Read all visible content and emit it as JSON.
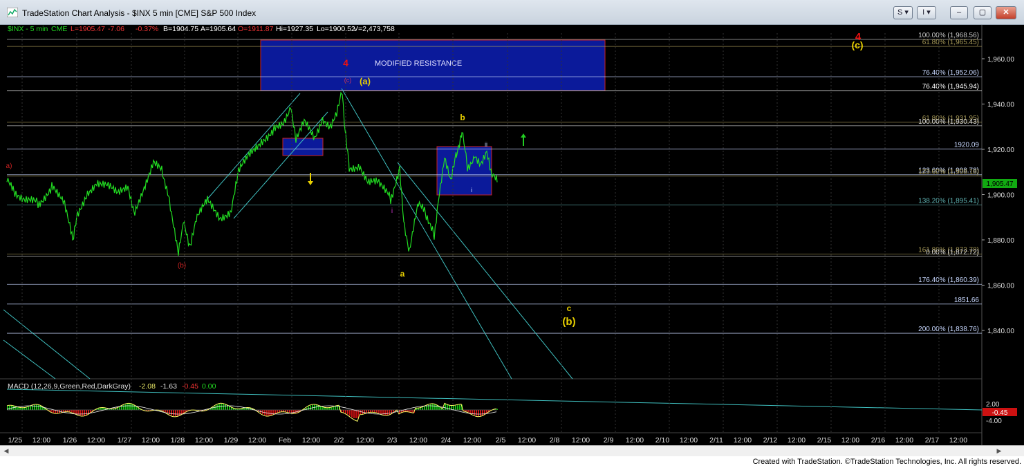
{
  "window": {
    "title": "TradeStation Chart Analysis - $INX 5 min [CME] S&P 500 Index",
    "buttons": [
      "S",
      "I"
    ]
  },
  "header": {
    "symbol": "$INX - 5 min",
    "exchange": "CME",
    "last": "L=1905.47",
    "change": "-7.06",
    "change_pct": "-0.37%",
    "bid": "B=1904.75",
    "ask": "A=1905.64",
    "open": "O=1911.87",
    "high": "Hi=1927.35",
    "low": "Lo=1900.52",
    "volume": "V=2,473,758"
  },
  "price_axis": {
    "ticks": [
      "1,960.00",
      "1,940.00",
      "1,920.00",
      "1,900.00",
      "1,880.00",
      "1,860.00",
      "1,840.00"
    ],
    "last_price": "1,905.47"
  },
  "level_labels": [
    {
      "text": "100.00% (1,968.56)",
      "price": 1968.56,
      "color": "#cccccc"
    },
    {
      "text": "61.80% (1,965.45)",
      "price": 1965.45,
      "color": "#a89a58"
    },
    {
      "text": "76.40% (1,952.06)",
      "price": 1952.06,
      "color": "#c8d8ff"
    },
    {
      "text": "76.40% (1,945.94)",
      "price": 1945.94,
      "color": "#ffffff"
    },
    {
      "text": "61.80% (1,931.95)",
      "price": 1931.95,
      "color": "#a89a58"
    },
    {
      "text": "100.00% (1,930.43)",
      "price": 1930.43,
      "color": "#d8d8d8"
    },
    {
      "text": "1920.09",
      "price": 1920.09,
      "color": "#c8d8ff"
    },
    {
      "text": "123.60% (1,908.78)",
      "price": 1908.78,
      "color": "#c8d8ff"
    },
    {
      "text": "123.60% (1,908.18)",
      "price": 1908.18,
      "color": "#a89a58"
    },
    {
      "text": "138.20% (1,895.41)",
      "price": 1895.41,
      "color": "#5fb3b3"
    },
    {
      "text": "161.80% (1,873.78)",
      "price": 1873.78,
      "color": "#a89a58"
    },
    {
      "text": "0.00% (1,872.72)",
      "price": 1872.72,
      "color": "#d8d8d8"
    },
    {
      "text": "176.40% (1,860.39)",
      "price": 1860.39,
      "color": "#c8d8ff"
    },
    {
      "text": "1851.66",
      "price": 1851.66,
      "color": "#c8d8ff"
    },
    {
      "text": "200.00% (1,838.76)",
      "price": 1838.76,
      "color": "#c8d8ff"
    }
  ],
  "annotations": {
    "resistance_box": "MODIFIED RESISTANCE",
    "wave_4_red": "4",
    "wave_c_small": "(c)",
    "wave_a_paren": "(a)",
    "wave_a_left": "a)",
    "wave_b_paren_red": "(b)",
    "wave_b": "b",
    "wave_ii": "ii",
    "wave_i_small": "i",
    "wave_i_magenta": "i",
    "wave_a": "a",
    "wave_c": "c",
    "wave_b_big": "(b)",
    "wave_4_top": "4",
    "wave_c_top": "(c)"
  },
  "time_axis": [
    "1/25",
    "12:00",
    "1/26",
    "12:00",
    "1/27",
    "12:00",
    "1/28",
    "12:00",
    "1/29",
    "12:00",
    "Feb",
    "12:00",
    "2/2",
    "12:00",
    "2/3",
    "12:00",
    "2/4",
    "12:00",
    "2/5",
    "12:00",
    "2/8",
    "12:00",
    "2/9",
    "12:00",
    "2/10",
    "12:00",
    "2/11",
    "12:00",
    "2/12",
    "12:00",
    "2/15",
    "12:00",
    "2/16",
    "12:00",
    "2/17",
    "12:00"
  ],
  "macd": {
    "label": "MACD (12,26,9,Green,Red,DarkGray)",
    "v1": "-2.08",
    "v2": "-1.63",
    "v3": "-0.45",
    "v4": "0.00",
    "axis": [
      "2.00",
      "-4.00"
    ],
    "current": "-0.45"
  },
  "footer": "Created with TradeStation. ©TradeStation Technologies, Inc. All rights reserved.",
  "colors": {
    "price": "#22dd22",
    "channel": "#3fbfbf",
    "box_fill": "#0b1a9a",
    "box_border": "#d22",
    "wave_yellow": "#e8d000",
    "wave_red": "#ee1111"
  }
}
